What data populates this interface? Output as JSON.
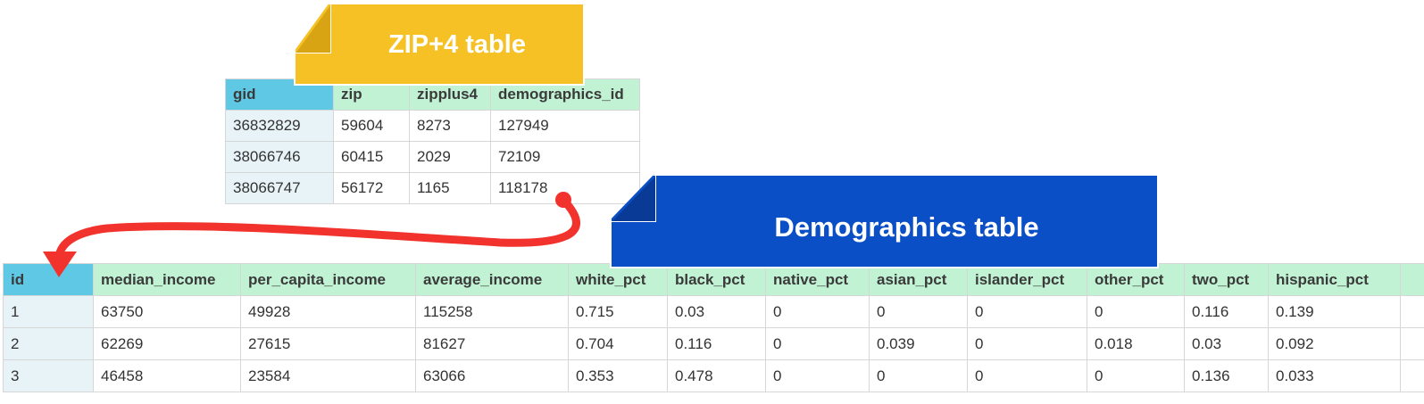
{
  "zip_table": {
    "title": "ZIP+4 table",
    "columns": [
      "gid",
      "zip",
      "zipplus4",
      "demographics_id"
    ],
    "rows": [
      [
        "36832829",
        "59604",
        "8273",
        "127949"
      ],
      [
        "38066746",
        "60415",
        "2029",
        "72109"
      ],
      [
        "38066747",
        "56172",
        "1165",
        "118178"
      ]
    ]
  },
  "demographics_table": {
    "title": "Demographics table",
    "columns": [
      "id",
      "median_income",
      "per_capita_income",
      "average_income",
      "white_pct",
      "black_pct",
      "native_pct",
      "asian_pct",
      "islander_pct",
      "other_pct",
      "two_pct",
      "hispanic_pct"
    ],
    "rows": [
      [
        "1",
        "63750",
        "49928",
        "115258",
        "0.715",
        "0.03",
        "0",
        "0",
        "0",
        "0",
        "0.116",
        "0.139"
      ],
      [
        "2",
        "62269",
        "27615",
        "81627",
        "0.704",
        "0.116",
        "0",
        "0.039",
        "0",
        "0.018",
        "0.03",
        "0.092"
      ],
      [
        "3",
        "46458",
        "23584",
        "63066",
        "0.353",
        "0.478",
        "0",
        "0",
        "0",
        "0",
        "0.136",
        "0.033"
      ]
    ]
  },
  "colors": {
    "key_header": "#5ec8e5",
    "column_header": "#c1f2d4",
    "key_cell": "#e8f3f8",
    "zip_callout": "#f5c125",
    "demo_callout": "#0b4fc6",
    "arrow": "#f2322c"
  }
}
